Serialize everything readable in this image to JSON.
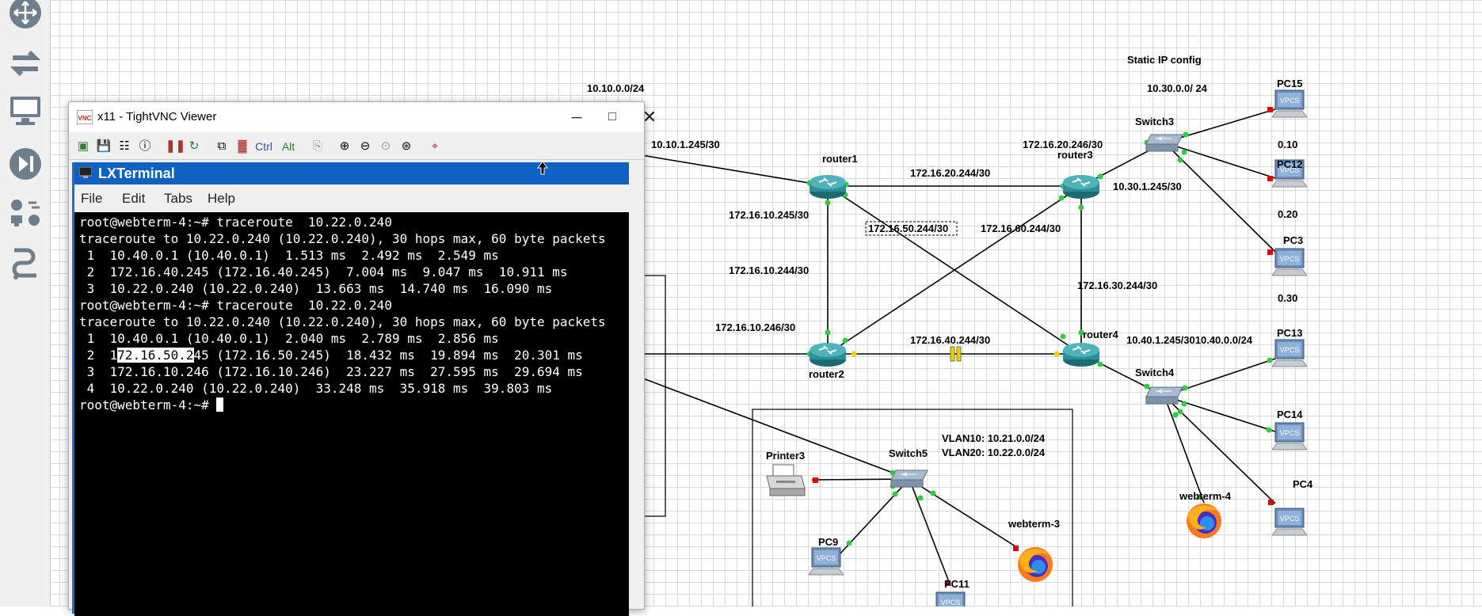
{
  "vnc_window": {
    "title": "x11 - TightVNC Viewer",
    "ctrl_label": "Ctrl",
    "alt_label": "Alt"
  },
  "terminal": {
    "title": "LXTerminal",
    "menu": [
      "File",
      "Edit",
      "Tabs",
      "Help"
    ],
    "lines": [
      "root@webterm-4:~# traceroute  10.22.0.240",
      "traceroute to 10.22.0.240 (10.22.0.240), 30 hops max, 60 byte packets",
      " 1  10.40.0.1 (10.40.0.1)  1.513 ms  2.492 ms  2.549 ms",
      " 2  172.16.40.245 (172.16.40.245)  7.004 ms  9.047 ms  10.911 ms",
      " 3  10.22.0.240 (10.22.0.240)  13.663 ms  14.740 ms  16.090 ms",
      "root@webterm-4:~# traceroute  10.22.0.240",
      "traceroute to 10.22.0.240 (10.22.0.240), 30 hops max, 60 byte packets",
      " 1  10.40.0.1 (10.40.0.1)  2.040 ms  2.789 ms  2.856 ms",
      " 2  1",
      "72.16.50.2",
      "45 (172.16.50.245)  18.432 ms  19.894 ms  20.301 ms",
      " 3  172.16.10.246 (172.16.10.246)  23.227 ms  27.595 ms  29.694 ms",
      " 4  10.22.0.240 (10.22.0.240)  33.248 ms  35.918 ms  39.803 ms",
      "root@webterm-4:~# "
    ]
  },
  "topology": {
    "devices": {
      "router1": "router1",
      "router2": "router2",
      "router3": "router3",
      "router4": "router4",
      "switch3": "Switch3",
      "switch4": "Switch4",
      "switch5": "Switch5",
      "pc15": "PC15",
      "pc12": "PC12",
      "pc3": "PC3",
      "pc13": "PC13",
      "pc14": "PC14",
      "pc4": "PC4",
      "pc9": "PC9",
      "pc11": "PC11",
      "printer3": "Printer3",
      "webterm3": "webterm-3",
      "webterm4": "webterm-4",
      "vpcs": "VPCS"
    },
    "labels": {
      "net_10_10": "10.10.0.0/24",
      "link_10_10_1_245": "10.10.1.245/30",
      "static_ip": "Static IP config",
      "net_10_30": "10.30.0.0/ 24",
      "link_172_16_20_246": "172.16.20.246/30",
      "link_172_16_20_244": "172.16.20.244/30",
      "link_10_30_1_245": "10.30.1.245/30",
      "ip_010": "0.10",
      "ip_020": "0.20",
      "ip_030": "0.30",
      "link_172_16_10_245": "172.16.10.245/30",
      "link_172_16_50_244": "172.16.50.244/30",
      "link_172_16_60_244": "172.16.60.244/30",
      "link_172_16_10_244": "172.16.10.244/30",
      "link_172_16_30_244": "172.16.30.244/30",
      "link_172_16_10_246": "172.16.10.246/30",
      "link_172_16_40_244": "172.16.40.244/30",
      "net_10_40": "10.40.1.245/3010.40.0.0/24",
      "vlan10": "VLAN10: 10.21.0.0/24",
      "vlan20": "VLAN20: 10.22.0.0/24"
    }
  }
}
